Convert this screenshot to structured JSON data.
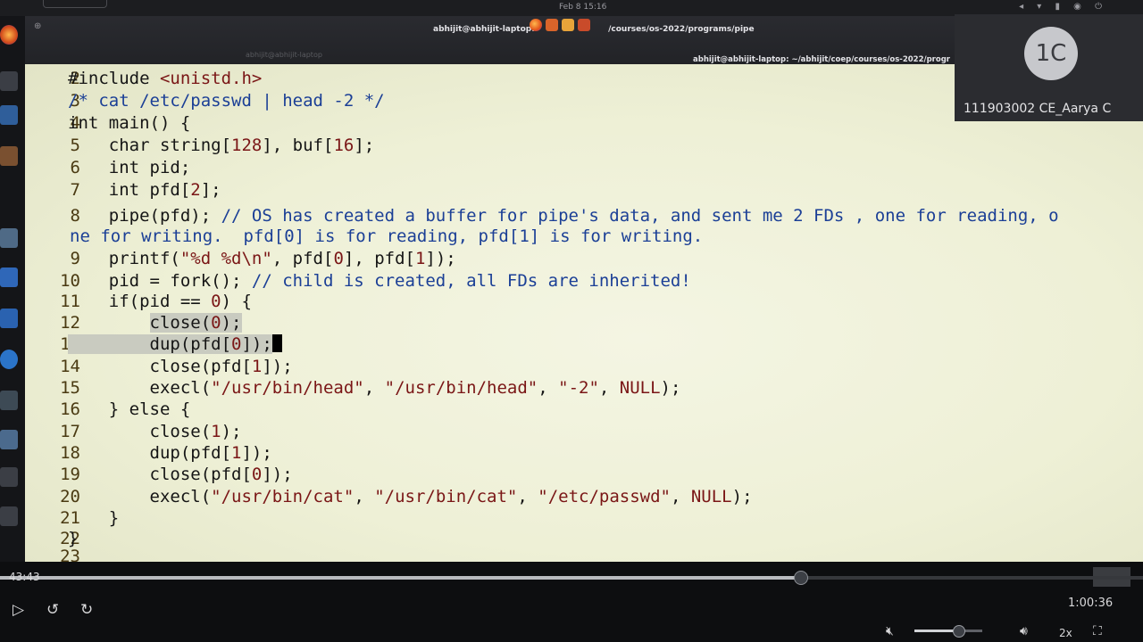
{
  "system": {
    "clock": "Feb 8  15:16",
    "tray_icons": [
      "network-icon",
      "volume-icon",
      "battery-icon",
      "power-icon"
    ]
  },
  "terminal": {
    "title_user": "abhijit@abhijit-laptop:",
    "title_path": "/courses/os-2022/programs/pipe",
    "subtitle": "abhijit@abhijit-laptop: ~/abhijit/coep/courses/os-2022/progr",
    "faint_tab": "abhijit@abhijit-laptop"
  },
  "editor": {
    "lines": [
      {
        "n": "2",
        "html": "#include <span class='str'>&lt;unistd.h&gt;</span>"
      },
      {
        "n": "3",
        "html": "<span class='cmt'>/* cat /etc/passwd | head -2 */</span>"
      },
      {
        "n": "4",
        "html": "int main() {"
      },
      {
        "n": "5",
        "html": "    char string[<span class='num'>128</span>], buf[<span class='num'>16</span>];"
      },
      {
        "n": "6",
        "html": "    int pid;"
      },
      {
        "n": "7",
        "html": "    int pfd[<span class='num'>2</span>];"
      },
      {
        "n": "8",
        "html": "    pipe(pfd); <span class='cmt'>// OS has created a buffer for pipe's data, and sent me 2 FDs , one for reading, o</span>"
      },
      {
        "n": "9",
        "html": "    printf(<span class='str'>\"%d %d\\n\"</span>, pfd[<span class='num'>0</span>], pfd[<span class='num'>1</span>]);"
      },
      {
        "n": "10",
        "html": "    pid = fork(); <span class='cmt'>// child is created, all FDs are inherited!</span>"
      },
      {
        "n": "11",
        "html": "    if(pid == <span class='num'>0</span>) {"
      },
      {
        "n": "12",
        "html": "        <span class='hl'>close(<span class='num'>0</span>);</span>"
      },
      {
        "n": "13",
        "html": "<span class='hl'>        dup(pfd[<span class='num'>0</span>]);</span><span class='cursor'></span>"
      },
      {
        "n": "14",
        "html": "        close(pfd[<span class='num'>1</span>]);"
      },
      {
        "n": "15",
        "html": "        execl(<span class='str'>\"/usr/bin/head\"</span>, <span class='str'>\"/usr/bin/head\"</span>, <span class='str'>\"-2\"</span>, <span class='str'>NULL</span>);"
      },
      {
        "n": "16",
        "html": "    } else {"
      },
      {
        "n": "17",
        "html": "        close(<span class='num'>1</span>);"
      },
      {
        "n": "18",
        "html": "        dup(pfd[<span class='num'>1</span>]);"
      },
      {
        "n": "19",
        "html": "        close(pfd[<span class='num'>0</span>]);"
      },
      {
        "n": "20",
        "html": "        execl(<span class='str'>\"/usr/bin/cat\"</span>, <span class='str'>\"/usr/bin/cat\"</span>, <span class='str'>\"/etc/passwd\"</span>, <span class='str'>NULL</span>);"
      },
      {
        "n": "21",
        "html": "    }"
      },
      {
        "n": "22",
        "html": "}"
      },
      {
        "n": "23",
        "html": ""
      }
    ],
    "wrap_html": "<span class='cmt'>ne for writing.  pfd[0] is for reading, pfd[1] is for writing.</span>"
  },
  "participant": {
    "initials": "1C",
    "name": "111903002 CE_Aarya C"
  },
  "player": {
    "elapsed": "43:43",
    "total": "1:00:36",
    "progress": 0.7,
    "volume": 0.65,
    "speed": "2x"
  }
}
